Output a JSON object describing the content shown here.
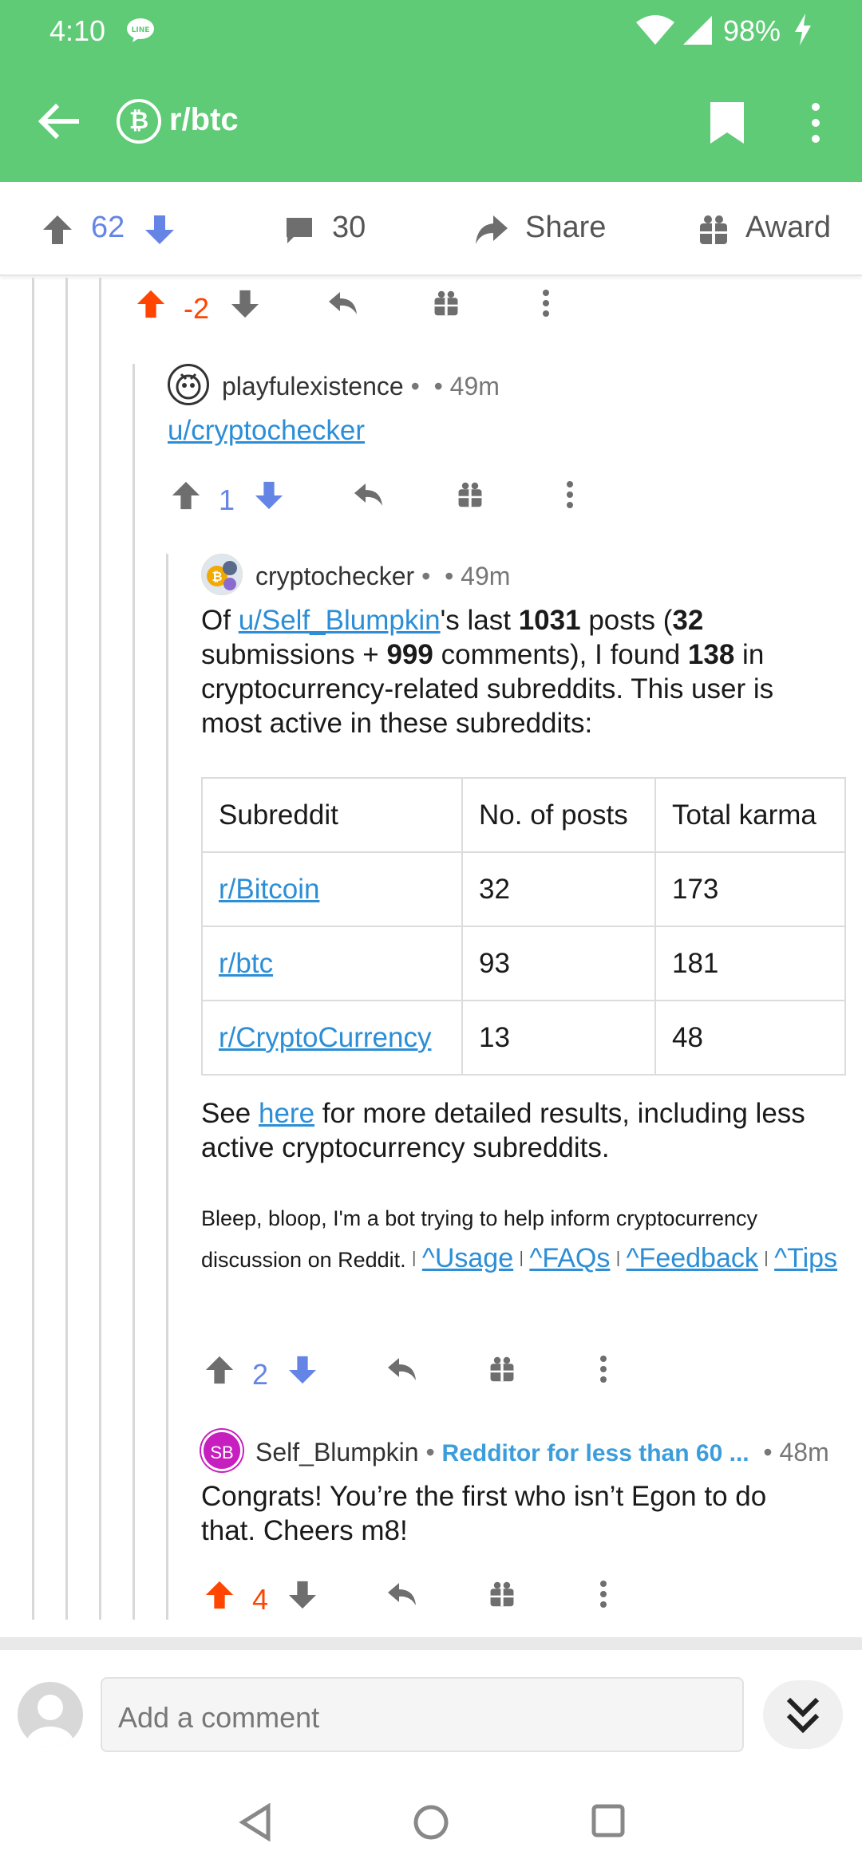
{
  "status_bar": {
    "time": "4:10",
    "battery": "98%"
  },
  "app_bar": {
    "subreddit_icon": "₿",
    "title": "r/btc"
  },
  "post_actions": {
    "score": "62",
    "comments": "30",
    "share_label": "Share",
    "award_label": "Award"
  },
  "comment_prev": {
    "score": "-2"
  },
  "comment_playful": {
    "author": "playfulexistence",
    "time": "49m",
    "link": "u/cryptochecker",
    "score": "1"
  },
  "comment_bot": {
    "author": "cryptochecker",
    "time": "49m",
    "text": {
      "p1": "Of ",
      "user_link": "u/Self_Blumpkin",
      "p2": "'s last ",
      "total_posts": "1031",
      "p3": " posts (",
      "submissions": "32",
      "p4": " submissions + ",
      "comments": "999",
      "p5": " comments), I found ",
      "found": "138",
      "p6": " in cryptocurrency-related subreddits. This user is most active in these subreddits:"
    },
    "table": {
      "headers": [
        "Subreddit",
        "No. of posts",
        "Total karma"
      ],
      "rows": [
        [
          "r/Bitcoin",
          "32",
          "173"
        ],
        [
          "r/btc",
          "93",
          "181"
        ],
        [
          "r/CryptoCurrency",
          "13",
          "48"
        ]
      ]
    },
    "see_pre": "See ",
    "see_link": "here",
    "see_post": " for more detailed results, including less active cryptocurrency subreddits.",
    "footer_text": "Bleep, bloop, I'm a bot trying to help inform cryptocurrency discussion on Reddit.",
    "footer_links": [
      "^Usage",
      "^FAQs",
      "^Feedback",
      "^Tips"
    ],
    "score": "2"
  },
  "comment_op": {
    "author": "Self_Blumpkin",
    "avatar_initials": "SB",
    "flair": "Redditor for less than 60 ...",
    "time": "48m",
    "text": "Congrats! You’re the first who isn’t Egon to do that.  Cheers m8!",
    "score": "4"
  },
  "comment_input": {
    "placeholder": "Add a comment"
  },
  "colors": {
    "brand_green": "#5fcb76",
    "upvote_orange": "#ff4500",
    "vote_blue": "#6585e6",
    "link_blue": "#2c8ed6",
    "flair_blue": "#3b9ddb"
  }
}
